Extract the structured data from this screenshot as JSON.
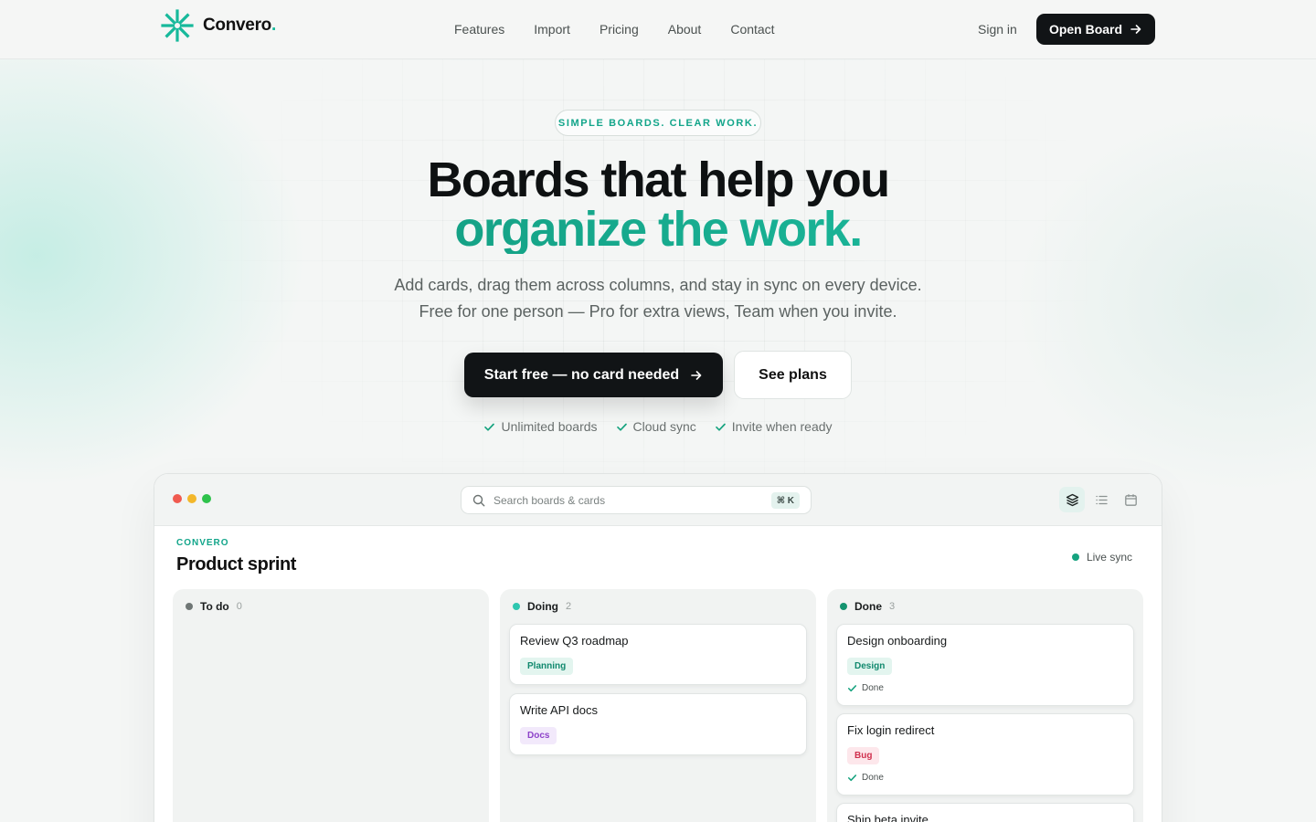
{
  "nav": {
    "brand": "Convero",
    "brand_dot": ".",
    "links": [
      "Features",
      "Import",
      "Pricing",
      "About",
      "Contact"
    ],
    "sign_in": "Sign in",
    "open_board": "Open Board"
  },
  "hero": {
    "eyebrow": "SIMPLE BOARDS. CLEAR WORK.",
    "title_line1": "Boards that help you",
    "title_line2": "organize the work.",
    "subtitle_line1": "Add cards, drag them across columns, and stay in sync on every device.",
    "subtitle_line2": "Free for one person — Pro for extra views, Team when you invite.",
    "primary_cta": "Start free — no card needed",
    "secondary_cta": "See plans",
    "checks": [
      "Unlimited boards",
      "Cloud sync",
      "Invite when ready"
    ]
  },
  "app": {
    "search_placeholder": "Search boards & cards",
    "search_shortcut": "⌘ K",
    "workspace": "CONVERO",
    "board_title": "Product sprint",
    "live_status": "Live sync",
    "columns": [
      {
        "name": "To do",
        "count": "0",
        "color": "#6f7675",
        "cards": []
      },
      {
        "name": "Doing",
        "count": "2",
        "color": "#2fc7b0",
        "cards": [
          {
            "title": "Review Q3 roadmap",
            "tag": "Planning"
          },
          {
            "title": "Write API docs",
            "tag": "Docs"
          }
        ]
      },
      {
        "name": "Done",
        "count": "3",
        "color": "#14936f",
        "cards": [
          {
            "title": "Design onboarding",
            "tag": "Design",
            "status": "Done"
          },
          {
            "title": "Fix login redirect",
            "tag": "Bug",
            "status": "Done"
          },
          {
            "title": "Ship beta invite"
          }
        ]
      }
    ]
  },
  "colors": {
    "accent": "#14b89a",
    "dark": "#111416",
    "window_red": "#f05a4f",
    "window_yellow": "#f3b72a",
    "window_green": "#2ec24b"
  }
}
